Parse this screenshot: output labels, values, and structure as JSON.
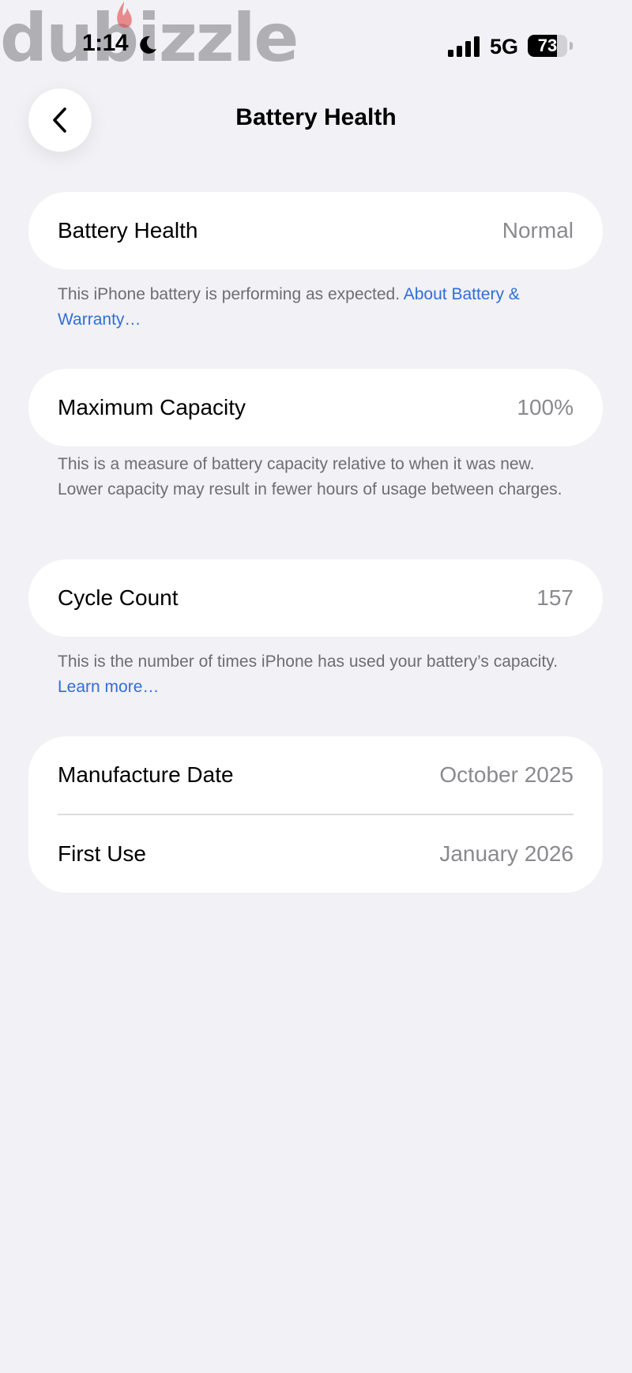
{
  "status_bar": {
    "watermark": "dubizzle",
    "time": "1:14",
    "network": "5G",
    "battery_level": "73",
    "battery_fraction": 0.73,
    "icons": [
      "moon-icon",
      "signal-icon",
      "battery-icon"
    ]
  },
  "nav": {
    "title": "Battery Health",
    "back_icon": "chevron-left-icon"
  },
  "sections": {
    "health": {
      "label": "Battery Health",
      "value": "Normal",
      "footnote": "This iPhone battery is performing as expected. ",
      "link": "About Battery & Warranty…"
    },
    "capacity": {
      "label": "Maximum Capacity",
      "value": "100%",
      "footnote": "This is a measure of battery capacity relative to when it was new. Lower capacity may result in fewer hours of usage between charges."
    },
    "cycles": {
      "label": "Cycle Count",
      "value": "157",
      "footnote": "This is the number of times iPhone has used your battery’s capacity. ",
      "link": "Learn more…"
    },
    "dates": {
      "manufacture_label": "Manufacture Date",
      "manufacture_value": "October 2025",
      "first_use_label": "First Use",
      "first_use_value": "January 2026"
    }
  },
  "colors": {
    "background": "#f1f1f6",
    "card": "#ffffff",
    "link": "#2f6fd6",
    "secondary_text": "#8a8a8e"
  }
}
